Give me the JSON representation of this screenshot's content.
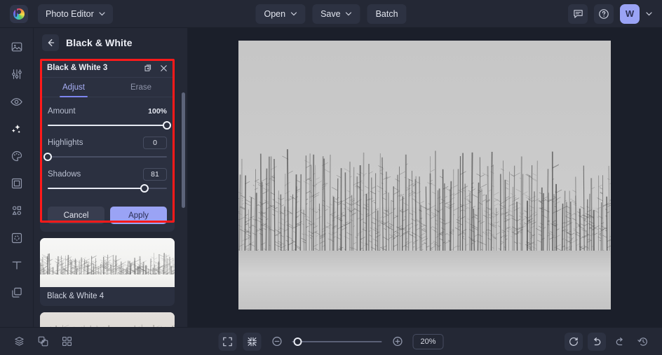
{
  "app": {
    "logo_icon": "befunky-color-wheel-logo",
    "menu_label": "Photo Editor"
  },
  "topbar": {
    "open_label": "Open",
    "save_label": "Save",
    "batch_label": "Batch",
    "feedback_icon": "chat-bubble-icon",
    "help_icon": "question-circle-icon",
    "avatar_initial": "W",
    "avatar_color": "#9aa3f5"
  },
  "sidebar": {
    "items": [
      {
        "name": "image",
        "icon": "image-icon",
        "active": false
      },
      {
        "name": "edit",
        "icon": "sliders-icon",
        "active": false
      },
      {
        "name": "touch-up",
        "icon": "eye-icon",
        "active": false
      },
      {
        "name": "effects",
        "icon": "sparkles-icon",
        "active": true
      },
      {
        "name": "artsy",
        "icon": "palette-icon",
        "active": false
      },
      {
        "name": "frames",
        "icon": "frame-icon",
        "active": false
      },
      {
        "name": "graphics",
        "icon": "shapes-icon",
        "active": false
      },
      {
        "name": "overlays",
        "icon": "overlay-icon",
        "active": false
      },
      {
        "name": "text",
        "icon": "text-t-icon",
        "active": false
      },
      {
        "name": "layers",
        "icon": "layers-icon",
        "active": false
      }
    ]
  },
  "panel": {
    "back_icon": "arrow-left-icon",
    "title": "Black & White",
    "modal": {
      "title": "Black & White 3",
      "duplicate_icon": "duplicate-layers-icon",
      "close_icon": "close-x-icon",
      "tabs": [
        {
          "label": "Adjust",
          "active": true
        },
        {
          "label": "Erase",
          "active": false
        }
      ],
      "controls": [
        {
          "label": "Amount",
          "value": "100%",
          "percent": 100,
          "boxed": false
        },
        {
          "label": "Highlights",
          "value": "0",
          "percent": 0,
          "boxed": true
        },
        {
          "label": "Shadows",
          "value": "81",
          "percent": 81,
          "boxed": true
        }
      ],
      "cancel_label": "Cancel",
      "apply_label": "Apply",
      "apply_color": "#9aa3f5"
    },
    "thumbnails": [
      {
        "label": "Black & White 4"
      },
      {
        "label": ""
      }
    ],
    "highlight_color": "#ff1a1a"
  },
  "canvas": {
    "image_description": "Black and white winter landscape photo of a row of bare poplar trees behind a snow covered field"
  },
  "bottombar": {
    "layers_icon": "layers-stack-icon",
    "compare_icon": "compare-split-icon",
    "grid_icon": "grid-view-icon",
    "fullscreen_icon": "expand-fullscreen-icon",
    "fit_icon": "fit-to-screen-icon",
    "zoom_out_icon": "zoom-minus-icon",
    "zoom_in_icon": "zoom-plus-icon",
    "zoom_value": "20%",
    "zoom_percent": 8,
    "reset_icon": "reset-rotate-icon",
    "undo_icon": "undo-arrow-icon",
    "redo_icon": "redo-arrow-icon",
    "history_icon": "history-clock-icon"
  }
}
